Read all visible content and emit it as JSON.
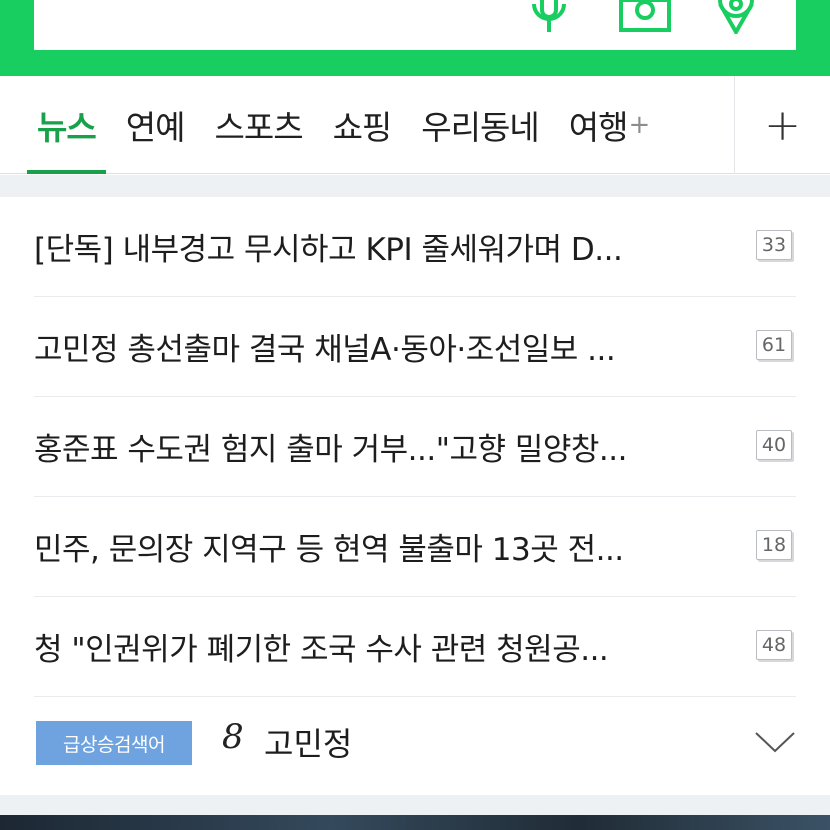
{
  "header": {
    "icons": [
      "voice-search-icon",
      "camera-search-icon",
      "location-icon"
    ],
    "accent": "#19ce60"
  },
  "tabs": [
    {
      "label": "뉴스",
      "active": true
    },
    {
      "label": "연예",
      "active": false
    },
    {
      "label": "스포츠",
      "active": false
    },
    {
      "label": "쇼핑",
      "active": false
    },
    {
      "label": "우리동네",
      "active": false
    },
    {
      "label": "여행",
      "suffix": "+",
      "active": false
    }
  ],
  "tab_add_label": "+",
  "news": [
    {
      "title": "[단독] 내부경고 무시하고 KPI 줄세워가며 D...",
      "count": "33"
    },
    {
      "title": "고민정 총선출마 결국 채널A·동아·조선일보 ...",
      "count": "61"
    },
    {
      "title": "홍준표 수도권 험지 출마 거부...\"고향 밀양창...",
      "count": "40"
    },
    {
      "title": "민주, 문의장 지역구 등 현역 불출마 13곳 전...",
      "count": "18"
    },
    {
      "title": "청 \"인권위가 폐기한 조국 수사 관련 청원공...",
      "count": "48"
    }
  ],
  "trending": {
    "badge": "급상승검색어",
    "rank": "8",
    "keyword": "고민정"
  }
}
